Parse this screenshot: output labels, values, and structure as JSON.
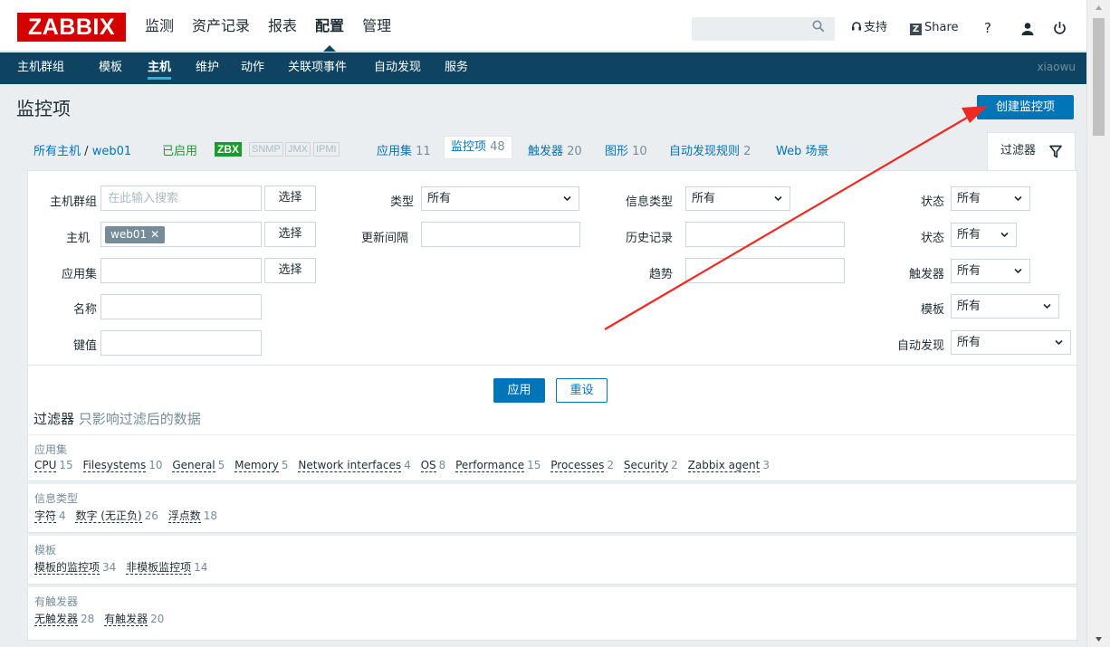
{
  "logo": "ZABBIX",
  "main_menu": [
    "监测",
    "资产记录",
    "报表",
    "配置",
    "管理"
  ],
  "main_menu_active": 3,
  "utilities": {
    "support": "支持",
    "share": "Share",
    "help": "?"
  },
  "sub_menu": [
    "主机群组",
    "模板",
    "主机",
    "维护",
    "动作",
    "关联项事件",
    "自动发现",
    "服务"
  ],
  "username": "xiaowu",
  "page_title": "监控项",
  "create_button": "创建监控项",
  "host_nav": {
    "all_hosts": "所有主机",
    "separator": "/",
    "host": "web01",
    "status": "已启用",
    "badges": [
      "ZBX",
      "SNMP",
      "JMX",
      "IPMI"
    ],
    "applications": {
      "label": "应用集",
      "count": "11"
    },
    "items": {
      "label": "监控项",
      "count": "48"
    },
    "triggers": {
      "label": "触发器",
      "count": "20"
    },
    "graphs": {
      "label": "图形",
      "count": "10"
    },
    "discovery": {
      "label": "自动发现规则",
      "count": "2"
    },
    "web": {
      "label": "Web 场景"
    },
    "filter_tab": "过滤器"
  },
  "filter": {
    "host_group_label": "主机群组",
    "host_group_placeholder": "在此输入搜索",
    "host_label": "主机",
    "host_chip": "web01",
    "application_label": "应用集",
    "name_label": "名称",
    "key_label": "键值",
    "select_label": "选择",
    "type_label": "类型",
    "type_value": "所有",
    "update_interval_label": "更新间隔",
    "info_type_label": "信息类型",
    "info_type_value": "所有",
    "history_label": "历史记录",
    "trends_label": "趋势",
    "state_label": "状态",
    "state_value": "所有",
    "status_label": "状态",
    "status_value": "所有",
    "triggers_label": "触发器",
    "triggers_value": "所有",
    "template_label": "模板",
    "template_value": "所有",
    "discovery_label": "自动发现",
    "discovery_value": "所有",
    "apply": "应用",
    "reset": "重设"
  },
  "subfilter": {
    "title": "过滤器",
    "hint": "只影响过滤后的数据",
    "groups": [
      {
        "title": "应用集",
        "items": [
          {
            "name": "CPU",
            "count": "15"
          },
          {
            "name": "Filesystems",
            "count": "10"
          },
          {
            "name": "General",
            "count": "5"
          },
          {
            "name": "Memory",
            "count": "5"
          },
          {
            "name": "Network interfaces",
            "count": "4"
          },
          {
            "name": "OS",
            "count": "8"
          },
          {
            "name": "Performance",
            "count": "15"
          },
          {
            "name": "Processes",
            "count": "2"
          },
          {
            "name": "Security",
            "count": "2"
          },
          {
            "name": "Zabbix agent",
            "count": "3"
          }
        ]
      },
      {
        "title": "信息类型",
        "items": [
          {
            "name": "字符",
            "count": "4"
          },
          {
            "name": "数字 (无正负)",
            "count": "26"
          },
          {
            "name": "浮点数",
            "count": "18"
          }
        ]
      },
      {
        "title": "模板",
        "items": [
          {
            "name": "模板的监控项",
            "count": "34"
          },
          {
            "name": "非模板监控项",
            "count": "14"
          }
        ]
      },
      {
        "title": "有触发器",
        "items": [
          {
            "name": "无触发器",
            "count": "28"
          },
          {
            "name": "有触发器",
            "count": "20"
          }
        ]
      }
    ]
  },
  "colors": {
    "brand": "#d40000",
    "nav_dark": "#0e4462",
    "primary": "#0275b8",
    "enabled": "#1a9c2a",
    "annotation_arrow": "#ee2a24"
  }
}
